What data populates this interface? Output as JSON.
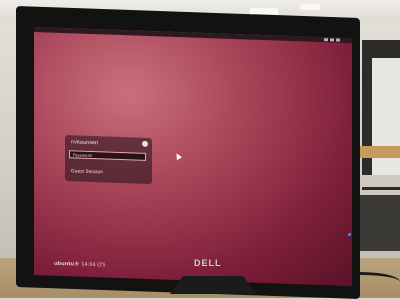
{
  "screen": {
    "login": {
      "username": "nvkaunsen",
      "password_placeholder": "Password",
      "guest_session": "Guest Session"
    },
    "logo_text": "ubuntu®",
    "logo_version": "14.04 LTS"
  },
  "monitor": {
    "brand": "DELL"
  },
  "colors": {
    "screen_wallpaper": "#a64357",
    "monitor_bezel": "#121212"
  }
}
